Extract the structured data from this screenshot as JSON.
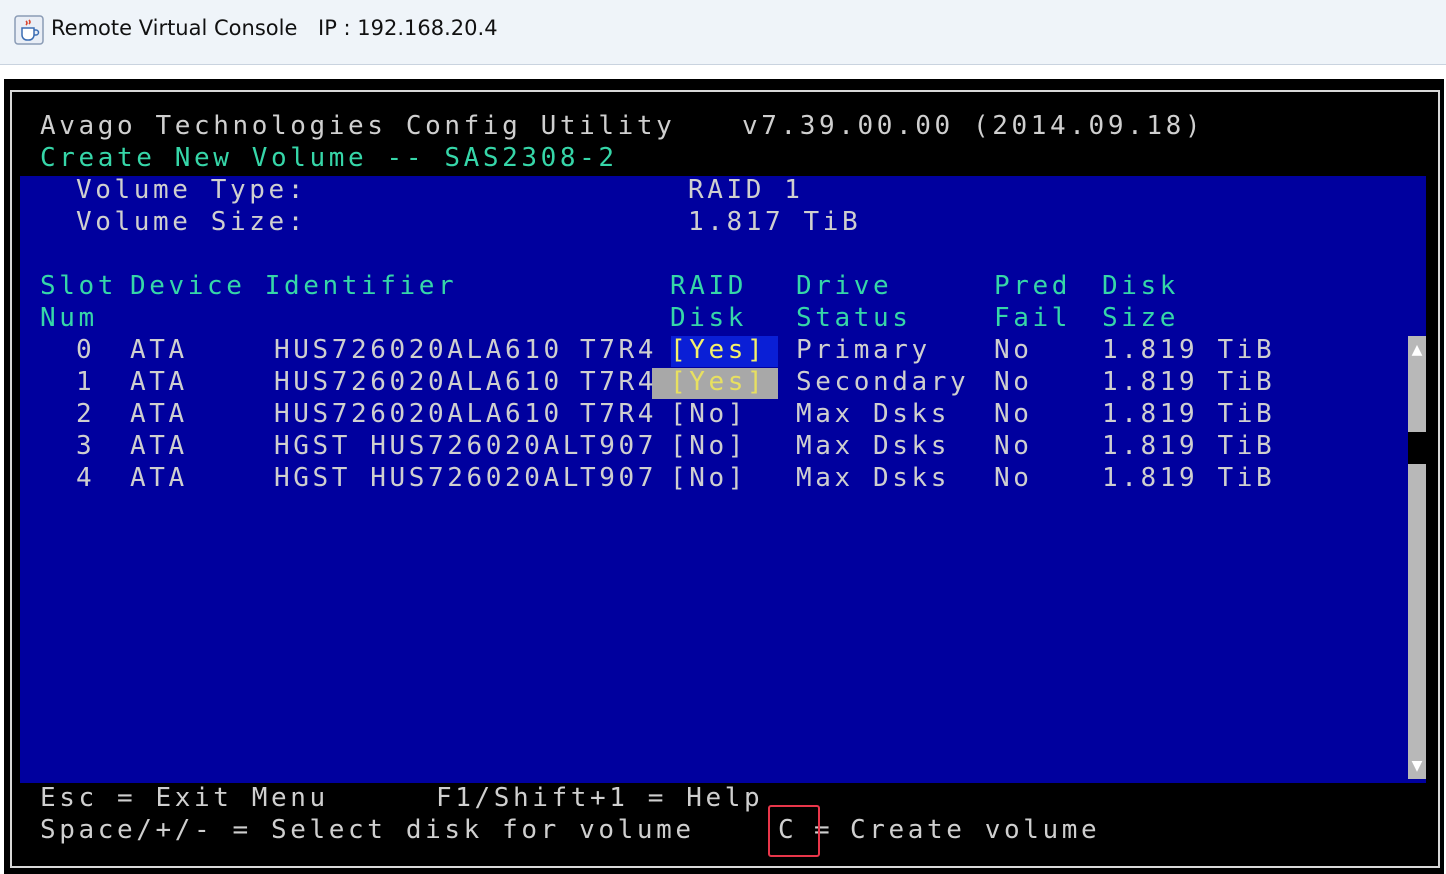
{
  "window": {
    "title": "Remote Virtual Console",
    "ip": "IP : 192.168.20.4",
    "icon": "java-cup-icon"
  },
  "header": {
    "app_name": "Avago Technologies Config Utility",
    "version": "v7.39.00.00 (2014.09.18)",
    "screen_title": "Create New Volume -- SAS2308-2"
  },
  "volume": {
    "type_label": "Volume Type:",
    "type_value": "RAID 1",
    "size_label": "Volume Size:",
    "size_value": "1.817 TiB"
  },
  "table": {
    "headers_row1": {
      "slot": "Slot",
      "device": "Device Identifier",
      "raid": "RAID",
      "drive": "Drive",
      "pred": "Pred",
      "disk": "Disk"
    },
    "headers_row2": {
      "slot": "Num",
      "raid": "Disk",
      "drive": "Status",
      "pred": "Fail",
      "disk": "Size"
    },
    "rows": [
      {
        "slot": "0",
        "vendor": "ATA",
        "model": "HUS726020ALA610",
        "rev": "T7R4",
        "raid": "[Yes]",
        "status": "Primary",
        "pred": "No",
        "size": "1.819 TiB"
      },
      {
        "slot": "1",
        "vendor": "ATA",
        "model": "HUS726020ALA610",
        "rev": "T7R4",
        "raid": "[Yes]",
        "status": "Secondary",
        "pred": "No",
        "size": "1.819 TiB"
      },
      {
        "slot": "2",
        "vendor": "ATA",
        "model": "HUS726020ALA610",
        "rev": "T7R4",
        "raid": "[No]",
        "status": "Max Dsks",
        "pred": "No",
        "size": "1.819 TiB"
      },
      {
        "slot": "3",
        "vendor": "ATA",
        "model": "HGST HUS726020AL",
        "rev": "T907",
        "raid": "[No]",
        "status": "Max Dsks",
        "pred": "No",
        "size": "1.819 TiB"
      },
      {
        "slot": "4",
        "vendor": "ATA",
        "model": "HGST HUS726020AL",
        "rev": "T907",
        "raid": "[No]",
        "status": "Max Dsks",
        "pred": "No",
        "size": "1.819 TiB"
      }
    ]
  },
  "footer": {
    "esc": "Esc = Exit Menu",
    "help": "F1/Shift+1 = Help",
    "select": "Space/+/- = Select disk for volume",
    "create_key": "C",
    "create_sep": "=",
    "create_label": "Create volume"
  },
  "scrollbar": {
    "up": "▲",
    "down": "▼"
  },
  "colors": {
    "panel_blue": "#00009e",
    "header_green": "#36d6a8",
    "text_white": "#cfcfcf",
    "selected_yellow": "#f4f06a",
    "highlight_red": "#e8364a"
  }
}
